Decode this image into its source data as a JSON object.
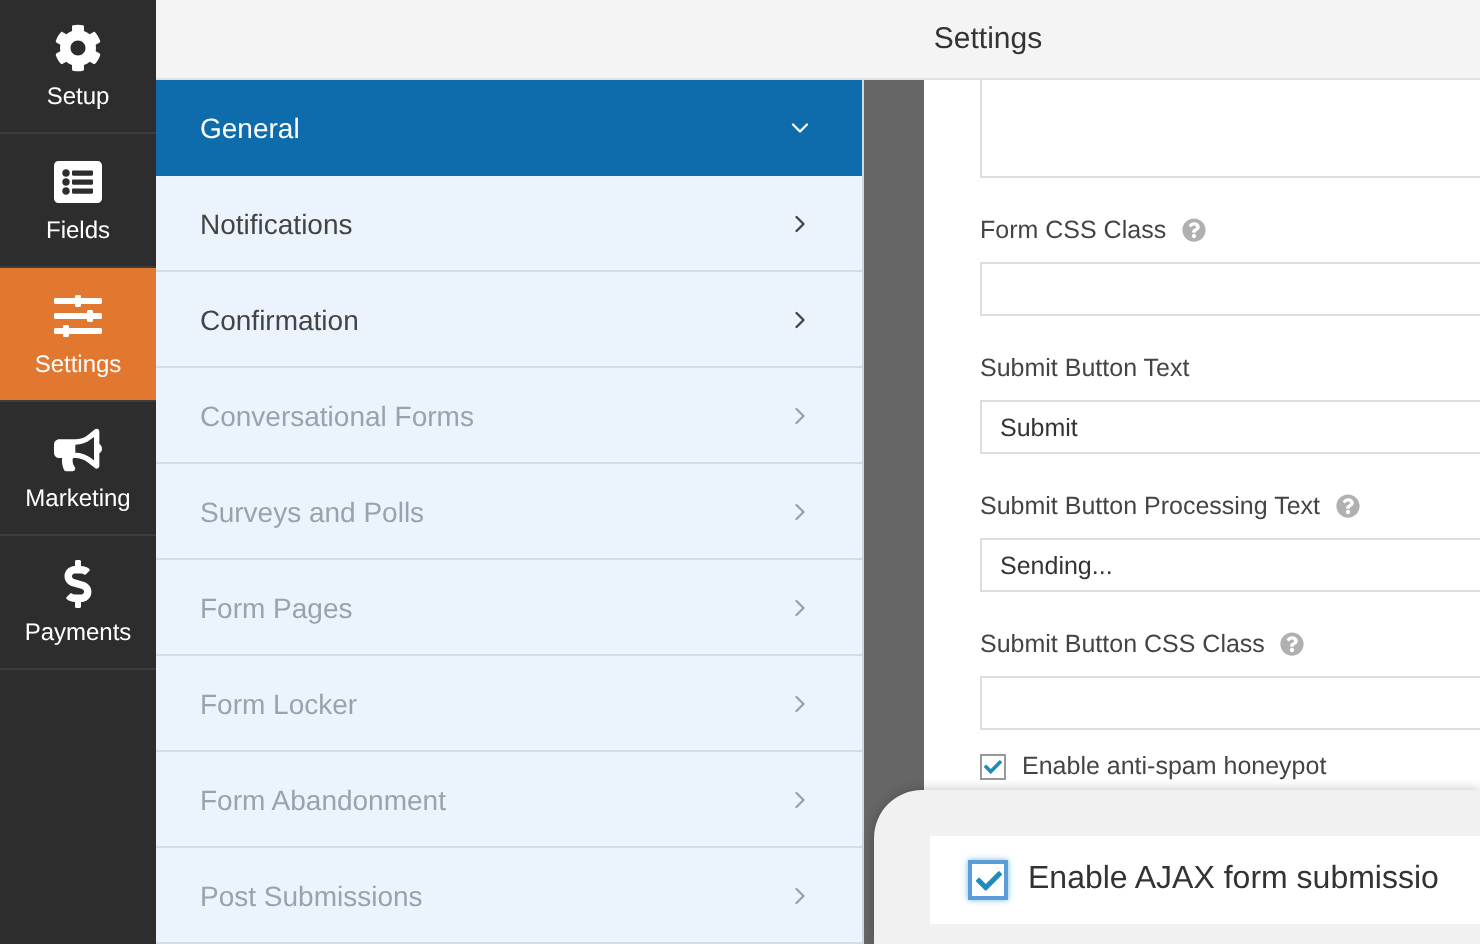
{
  "window": {
    "title": "Settings"
  },
  "nav": [
    {
      "label": "Setup",
      "selected": false
    },
    {
      "label": "Fields",
      "selected": false
    },
    {
      "label": "Settings",
      "selected": true
    },
    {
      "label": "Marketing",
      "selected": false
    },
    {
      "label": "Payments",
      "selected": false
    }
  ],
  "sections": [
    {
      "label": "General",
      "selected": true,
      "disabled": false
    },
    {
      "label": "Notifications",
      "selected": false,
      "disabled": false
    },
    {
      "label": "Confirmation",
      "selected": false,
      "disabled": false
    },
    {
      "label": "Conversational Forms",
      "selected": false,
      "disabled": true
    },
    {
      "label": "Surveys and Polls",
      "selected": false,
      "disabled": true
    },
    {
      "label": "Form Pages",
      "selected": false,
      "disabled": true
    },
    {
      "label": "Form Locker",
      "selected": false,
      "disabled": true
    },
    {
      "label": "Form Abandonment",
      "selected": false,
      "disabled": true
    },
    {
      "label": "Post Submissions",
      "selected": false,
      "disabled": true
    }
  ],
  "fields": [
    {
      "kind": "textarea"
    },
    {
      "kind": "input",
      "label": "Form CSS Class",
      "help": true
    },
    {
      "kind": "input",
      "label": "Submit Button Text",
      "help": false,
      "value": "Submit"
    },
    {
      "kind": "input",
      "label": "Submit Button Processing Text",
      "help": true,
      "value": "Sending..."
    },
    {
      "kind": "input",
      "label": "Submit Button CSS Class",
      "help": true
    }
  ],
  "checkboxes": [
    {
      "label": "Enable anti-spam honeypot",
      "checked": true
    }
  ],
  "callout": {
    "label": "Enable AJAX form submissio",
    "checked": true
  }
}
